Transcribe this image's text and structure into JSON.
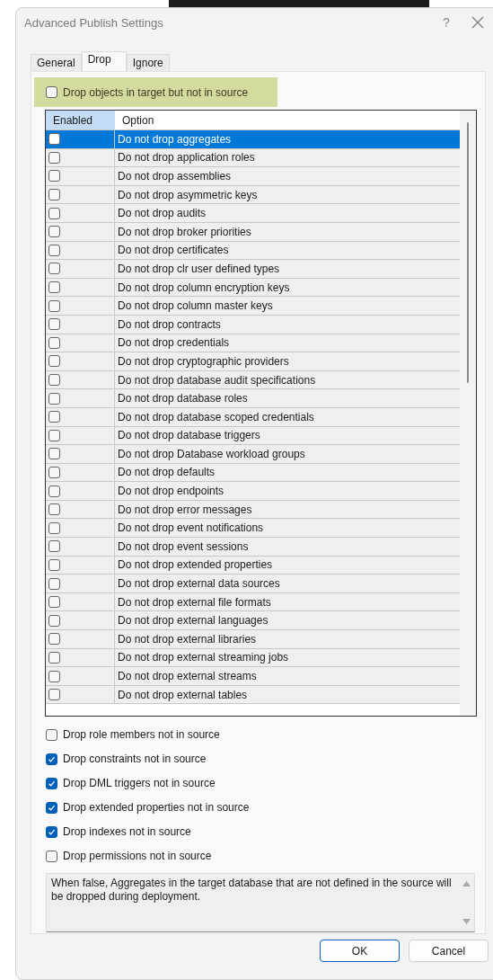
{
  "window": {
    "title": "Advanced Publish Settings",
    "help": "?"
  },
  "tabs": [
    {
      "label": "General",
      "selected": false
    },
    {
      "label": "Drop",
      "selected": true
    },
    {
      "label": "Ignore",
      "selected": false
    }
  ],
  "drop_all": {
    "label": "Drop objects in target but not in source",
    "checked": false
  },
  "grid": {
    "columns": [
      "Enabled",
      "Option"
    ],
    "rows": [
      {
        "option": "Do not drop aggregates",
        "checked": false,
        "selected": true
      },
      {
        "option": "Do not drop application roles",
        "checked": false,
        "selected": false
      },
      {
        "option": "Do not drop assemblies",
        "checked": false,
        "selected": false
      },
      {
        "option": "Do not drop asymmetric keys",
        "checked": false,
        "selected": false
      },
      {
        "option": "Do not drop audits",
        "checked": false,
        "selected": false
      },
      {
        "option": "Do not drop broker priorities",
        "checked": false,
        "selected": false
      },
      {
        "option": "Do not drop certificates",
        "checked": false,
        "selected": false
      },
      {
        "option": "Do not drop clr user defined types",
        "checked": false,
        "selected": false
      },
      {
        "option": "Do not drop column encryption keys",
        "checked": false,
        "selected": false
      },
      {
        "option": "Do not drop column master keys",
        "checked": false,
        "selected": false
      },
      {
        "option": "Do not drop contracts",
        "checked": false,
        "selected": false
      },
      {
        "option": "Do not drop credentials",
        "checked": false,
        "selected": false
      },
      {
        "option": "Do not drop cryptographic providers",
        "checked": false,
        "selected": false
      },
      {
        "option": "Do not drop database audit specifications",
        "checked": false,
        "selected": false
      },
      {
        "option": "Do not drop database roles",
        "checked": false,
        "selected": false
      },
      {
        "option": "Do not drop database scoped credentials",
        "checked": false,
        "selected": false
      },
      {
        "option": "Do not drop database triggers",
        "checked": false,
        "selected": false
      },
      {
        "option": "Do not drop Database workload groups",
        "checked": false,
        "selected": false
      },
      {
        "option": "Do not drop defaults",
        "checked": false,
        "selected": false
      },
      {
        "option": "Do not drop endpoints",
        "checked": false,
        "selected": false
      },
      {
        "option": "Do not drop error messages",
        "checked": false,
        "selected": false
      },
      {
        "option": "Do not drop event notifications",
        "checked": false,
        "selected": false
      },
      {
        "option": "Do not drop event sessions",
        "checked": false,
        "selected": false
      },
      {
        "option": "Do not drop extended properties",
        "checked": false,
        "selected": false
      },
      {
        "option": "Do not drop external data sources",
        "checked": false,
        "selected": false
      },
      {
        "option": "Do not drop external file formats",
        "checked": false,
        "selected": false
      },
      {
        "option": "Do not drop external languages",
        "checked": false,
        "selected": false
      },
      {
        "option": "Do not drop external libraries",
        "checked": false,
        "selected": false
      },
      {
        "option": "Do not drop external streaming jobs",
        "checked": false,
        "selected": false
      },
      {
        "option": "Do not drop external streams",
        "checked": false,
        "selected": false
      },
      {
        "option": "Do not drop external tables",
        "checked": false,
        "selected": false
      }
    ]
  },
  "options": [
    {
      "label": "Drop role members not in source",
      "checked": false
    },
    {
      "label": "Drop constraints not in source",
      "checked": true
    },
    {
      "label": "Drop DML triggers not in source",
      "checked": true
    },
    {
      "label": "Drop extended properties not in source",
      "checked": true
    },
    {
      "label": "Drop indexes not in source",
      "checked": true
    },
    {
      "label": "Drop permissions not in source",
      "checked": false
    }
  ],
  "description": "When false, Aggregates in the target database that are not defined in the source will be dropped during deployment.",
  "buttons": [
    {
      "label": "OK",
      "default": true
    },
    {
      "label": "Cancel",
      "default": false
    }
  ]
}
